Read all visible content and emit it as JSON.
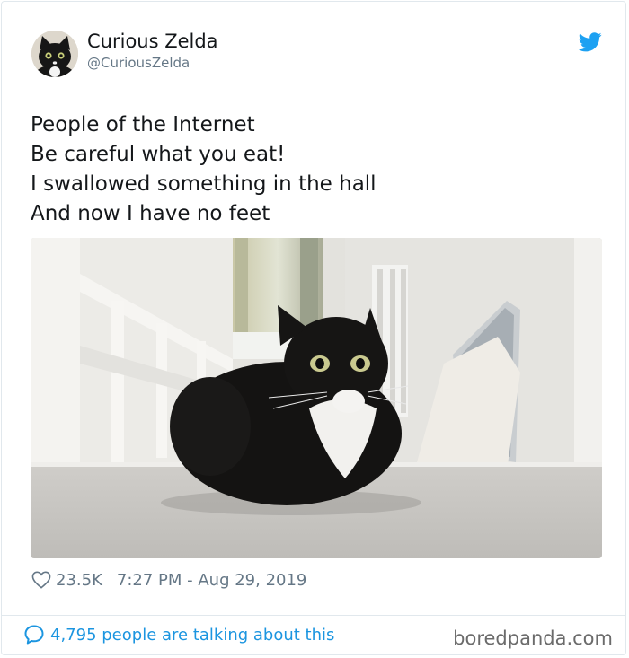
{
  "tweet": {
    "author": {
      "display_name": "Curious Zelda",
      "handle": "@CuriousZelda",
      "avatar_icon": "black-cat-avatar"
    },
    "platform_icon": "twitter-bird-icon",
    "text_lines": [
      "People of the Internet",
      "Be careful what you eat!",
      "I swallowed something in the hall",
      "And now I have no feet"
    ],
    "photo_icon": "cat-photo",
    "likes": "23.5K",
    "timestamp": "7:27 PM - Aug 29, 2019",
    "conversation": "4,795 people are talking about this"
  },
  "watermark": "boredpanda.com",
  "colors": {
    "link_blue": "#1b95e0",
    "twitter_blue": "#1da1f2",
    "muted_gray": "#657786",
    "text": "#14171a",
    "border": "#e1e8ed"
  }
}
